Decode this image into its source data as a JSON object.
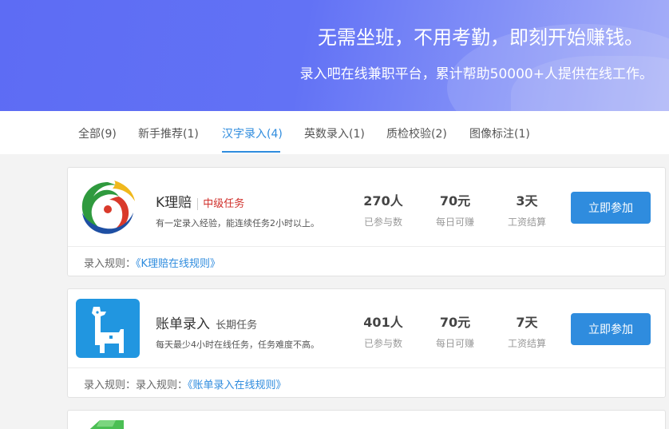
{
  "banner": {
    "title": "无需坐班，不用考勤，即刻开始赚钱。",
    "subtitle": "录入吧在线兼职平台，累计帮助50000+人提供在线工作。"
  },
  "tabs": [
    {
      "label": "全部(9)"
    },
    {
      "label": "新手推荐(1)"
    },
    {
      "label": "汉字录入(4)",
      "active": true
    },
    {
      "label": "英数录入(1)"
    },
    {
      "label": "质检校验(2)"
    },
    {
      "label": "图像标注(1)"
    }
  ],
  "tasks": [
    {
      "name": "K理赔",
      "tag": "中级任务",
      "desc": "有一定录入经验，能连续任务2小时以上。",
      "participants": "270人",
      "participants_label": "已参与数",
      "daily": "70元",
      "daily_label": "每日可赚",
      "settle": "3天",
      "settle_label": "工资结算",
      "join": "立即参加",
      "rule_prefix": "录入规则：",
      "rule_link": "《K理赔在线规则》"
    },
    {
      "name": "账单录入",
      "tag": "长期任务",
      "desc": "每天最少4小时在线任务，任务难度不高。",
      "participants": "401人",
      "participants_label": "已参与数",
      "daily": "70元",
      "daily_label": "每日可赚",
      "settle": "7天",
      "settle_label": "工资结算",
      "join": "立即参加",
      "rule_prefix": "录入规则：录入规则：",
      "rule_link": "《账单录入在线规则》"
    }
  ],
  "colors": {
    "accent": "#2f8cde",
    "banner": "#6272f5",
    "tag_red": "#d0302b"
  },
  "icons": [
    "k-claims-logo-icon",
    "giraffe-logo-icon"
  ]
}
